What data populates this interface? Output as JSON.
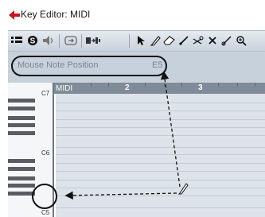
{
  "window": {
    "title": "Key Editor: MIDI"
  },
  "toolbar": {
    "icons": [
      "info-line-toggle-icon",
      "solo-icon",
      "acoustic-feedback-icon",
      "autoscroll-icon",
      "insert-velocity-icon",
      "object-selection-icon",
      "draw-icon",
      "erase-icon",
      "line-icon",
      "split-icon",
      "mute-icon",
      "cut-icon",
      "zoom-icon"
    ]
  },
  "info_line": {
    "label": "Mouse Note Position",
    "value": "E5"
  },
  "ruler": {
    "track_label": "MIDI",
    "bars": [
      "2",
      "3"
    ]
  },
  "keyboard": {
    "labels": [
      "C7",
      "C6",
      "C5"
    ]
  },
  "colors": {
    "toolbar_bg": "#d4dce4",
    "info_line_bg": "#c7d1dc",
    "grid_bg": "#dde3e9",
    "ruler_bg": "#7f8b98",
    "annotation": "#111111"
  }
}
